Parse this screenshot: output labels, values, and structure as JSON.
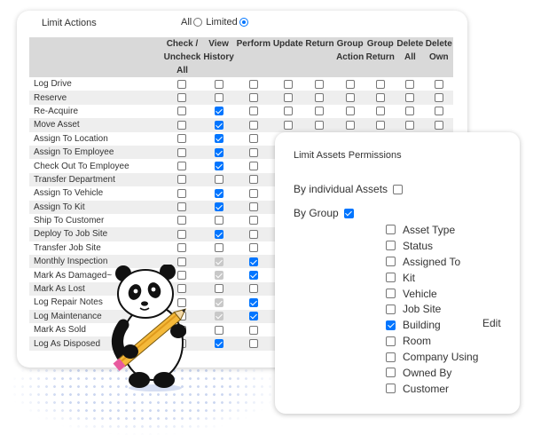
{
  "header": {
    "title": "Limit Actions",
    "scope_all": "All",
    "scope_limited": "Limited",
    "selected_scope": "Limited"
  },
  "table": {
    "columns": [
      [
        "Check /",
        "Uncheck",
        "All"
      ],
      [
        "View",
        "History",
        ""
      ],
      [
        "",
        "Perform",
        ""
      ],
      [
        "",
        "Update",
        ""
      ],
      [
        "",
        "Return",
        ""
      ],
      [
        "Group",
        "Action",
        ""
      ],
      [
        "Group",
        "Return",
        ""
      ],
      [
        "Delete",
        "All",
        ""
      ],
      [
        "Delete",
        "Own",
        ""
      ]
    ],
    "rows": [
      {
        "label": "Log Drive",
        "checks": [
          0,
          0,
          0,
          0,
          0,
          0,
          0,
          0,
          0
        ]
      },
      {
        "label": "Reserve",
        "checks": [
          0,
          0,
          0,
          0,
          0,
          0,
          0,
          0,
          0
        ]
      },
      {
        "label": "Re-Acquire",
        "checks": [
          0,
          1,
          0,
          0,
          0,
          0,
          0,
          0,
          0
        ]
      },
      {
        "label": "Move Asset",
        "checks": [
          0,
          1,
          0,
          0,
          0,
          0,
          0,
          0,
          0
        ]
      },
      {
        "label": "Assign To Location",
        "checks": [
          0,
          1,
          0,
          0,
          0,
          0,
          0,
          0,
          0
        ]
      },
      {
        "label": "Assign To Employee",
        "checks": [
          0,
          1,
          0,
          0,
          0,
          0,
          0,
          0,
          0
        ]
      },
      {
        "label": "Check Out To Employee",
        "checks": [
          0,
          1,
          0,
          0,
          0,
          0,
          0,
          0,
          0
        ]
      },
      {
        "label": "Transfer Department",
        "checks": [
          0,
          0,
          0,
          0,
          0,
          0,
          0,
          0,
          0
        ]
      },
      {
        "label": "Assign To Vehicle",
        "checks": [
          0,
          1,
          0,
          0,
          0,
          0,
          0,
          0,
          0
        ]
      },
      {
        "label": "Assign To Kit",
        "checks": [
          0,
          1,
          0,
          0,
          0,
          0,
          0,
          0,
          0
        ]
      },
      {
        "label": "Ship To Customer",
        "checks": [
          0,
          0,
          0,
          0,
          0,
          0,
          0,
          0,
          0
        ]
      },
      {
        "label": "Deploy To Job Site",
        "checks": [
          0,
          1,
          0,
          0,
          0,
          0,
          0,
          0,
          0
        ]
      },
      {
        "label": "Transfer Job Site",
        "checks": [
          0,
          0,
          0,
          0,
          0,
          0,
          0,
          0,
          0
        ]
      },
      {
        "label": "Monthly Inspection",
        "checks": [
          0,
          2,
          1,
          0,
          0,
          0,
          0,
          0,
          0
        ]
      },
      {
        "label": "Mark As Damaged~",
        "checks": [
          0,
          2,
          1,
          0,
          0,
          0,
          0,
          0,
          0
        ]
      },
      {
        "label": "Mark As Lost",
        "checks": [
          0,
          0,
          0,
          0,
          0,
          0,
          0,
          0,
          0
        ]
      },
      {
        "label": "Log Repair Notes",
        "checks": [
          0,
          2,
          1,
          0,
          0,
          0,
          0,
          0,
          0
        ]
      },
      {
        "label": "Log Maintenance",
        "checks": [
          0,
          2,
          1,
          0,
          0,
          0,
          0,
          0,
          0
        ]
      },
      {
        "label": "Mark As Sold",
        "checks": [
          0,
          0,
          0,
          0,
          0,
          0,
          0,
          0,
          0
        ]
      },
      {
        "label": "Log As Disposed",
        "checks": [
          0,
          1,
          0,
          0,
          0,
          0,
          0,
          0,
          0
        ]
      }
    ]
  },
  "limit_assets": {
    "title": "Limit Assets Permissions",
    "by_individual_label": "By individual Assets",
    "by_individual_checked": false,
    "by_group_label": "By Group",
    "by_group_checked": true,
    "groups": [
      {
        "label": "Asset Type",
        "checked": false
      },
      {
        "label": "Status",
        "checked": false
      },
      {
        "label": "Assigned To",
        "checked": false
      },
      {
        "label": "Kit",
        "checked": false
      },
      {
        "label": "Vehicle",
        "checked": false
      },
      {
        "label": "Job Site",
        "checked": false
      },
      {
        "label": "Building",
        "checked": true
      },
      {
        "label": "Room",
        "checked": false
      },
      {
        "label": "Company Using",
        "checked": false
      },
      {
        "label": "Owned By",
        "checked": false
      },
      {
        "label": "Customer",
        "checked": false
      }
    ],
    "edit_label": "Edit"
  },
  "colors": {
    "accent": "#0075ff",
    "header_bg": "#d9d9d9",
    "stripe": "#eeeeee",
    "disabled_check": "#c8c8c8"
  },
  "illustration": {
    "icon": "panda-with-pencil-icon"
  }
}
